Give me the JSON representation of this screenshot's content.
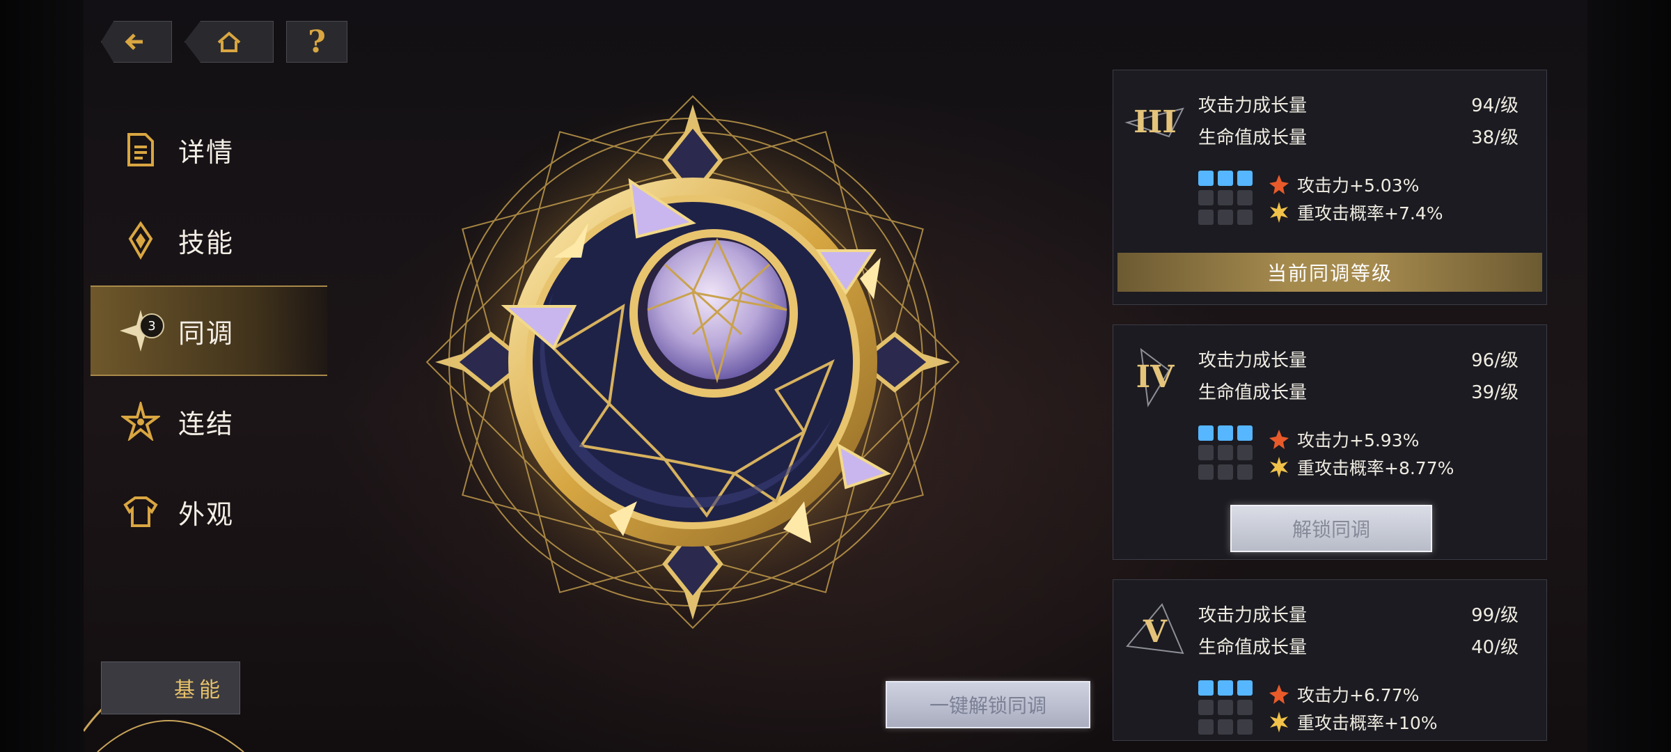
{
  "nav": {
    "items": [
      {
        "label": "详情"
      },
      {
        "label": "技能"
      },
      {
        "label": "同调",
        "badge": "3"
      },
      {
        "label": "连结"
      },
      {
        "label": "外观"
      }
    ]
  },
  "top_buttons": {
    "help": "?"
  },
  "base_button": {
    "label": "基能"
  },
  "unlock_all": {
    "label": "一键解锁同调"
  },
  "cards": [
    {
      "tier": "III",
      "atk_growth_label": "攻击力成长量",
      "atk_growth_value": "94/级",
      "hp_growth_label": "生命值成长量",
      "hp_growth_value": "38/级",
      "bonus_atk": "攻击力+5.03%",
      "bonus_crit": "重攻击概率+7.4%",
      "status": "当前同调等级"
    },
    {
      "tier": "IV",
      "atk_growth_label": "攻击力成长量",
      "atk_growth_value": "96/级",
      "hp_growth_label": "生命值成长量",
      "hp_growth_value": "39/级",
      "bonus_atk": "攻击力+5.93%",
      "bonus_crit": "重攻击概率+8.77%",
      "action": "解锁同调"
    },
    {
      "tier": "V",
      "atk_growth_label": "攻击力成长量",
      "atk_growth_value": "99/级",
      "hp_growth_label": "生命值成长量",
      "hp_growth_value": "40/级",
      "bonus_atk": "攻击力+6.77%",
      "bonus_crit": "重攻击概率+10%"
    }
  ],
  "colors": {
    "gold": "#d9a641",
    "accent_blue": "#56b6ff"
  },
  "icons": [
    "back-arrow-icon",
    "home-icon",
    "help-icon",
    "details-icon",
    "skills-icon",
    "sync-icon",
    "link-icon",
    "appearance-icon",
    "attack-icon",
    "crit-icon",
    "constellation-icon"
  ]
}
